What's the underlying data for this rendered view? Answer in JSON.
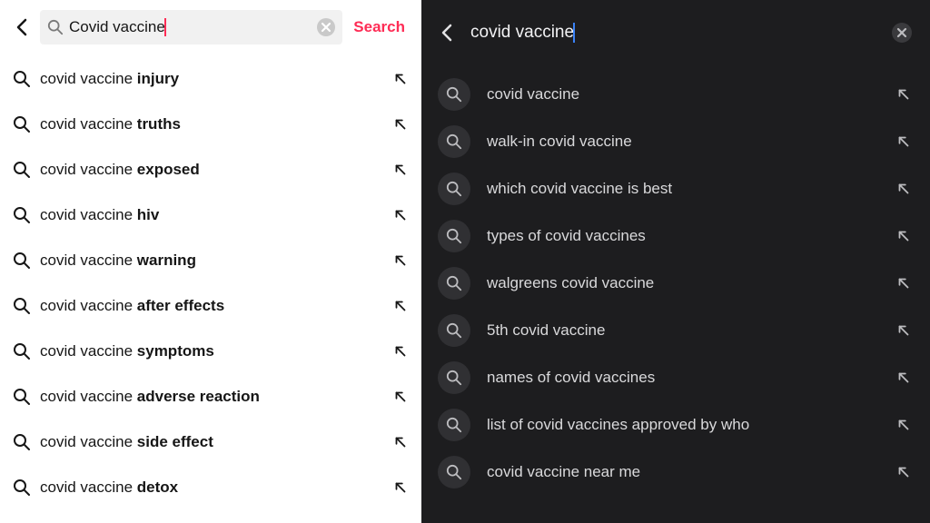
{
  "left": {
    "query": "Covid vaccine",
    "search_button_label": "Search",
    "suggestions": [
      {
        "prefix": "covid vaccine ",
        "bold": "injury"
      },
      {
        "prefix": "covid vaccine ",
        "bold": "truths"
      },
      {
        "prefix": "covid vaccine ",
        "bold": "exposed"
      },
      {
        "prefix": "covid vaccine ",
        "bold": "hiv"
      },
      {
        "prefix": "covid vaccine ",
        "bold": "warning"
      },
      {
        "prefix": "covid vaccine ",
        "bold": "after effects"
      },
      {
        "prefix": "covid vaccine ",
        "bold": "symptoms"
      },
      {
        "prefix": "covid vaccine ",
        "bold": "adverse reaction"
      },
      {
        "prefix": "covid vaccine ",
        "bold": "side effect"
      },
      {
        "prefix": "covid vaccine ",
        "bold": "detox"
      }
    ]
  },
  "right": {
    "query": "covid vaccine",
    "suggestions": [
      "covid vaccine",
      "walk-in covid vaccine",
      "which covid vaccine is best",
      "types of covid vaccines",
      "walgreens covid vaccine",
      "5th covid vaccine",
      "names of covid vaccines",
      "list of covid vaccines approved by who",
      "covid vaccine near me"
    ]
  },
  "colors": {
    "accent_red": "#fe2c55",
    "accent_blue": "#3a82f7",
    "dark_bg": "#1d1d1f"
  }
}
